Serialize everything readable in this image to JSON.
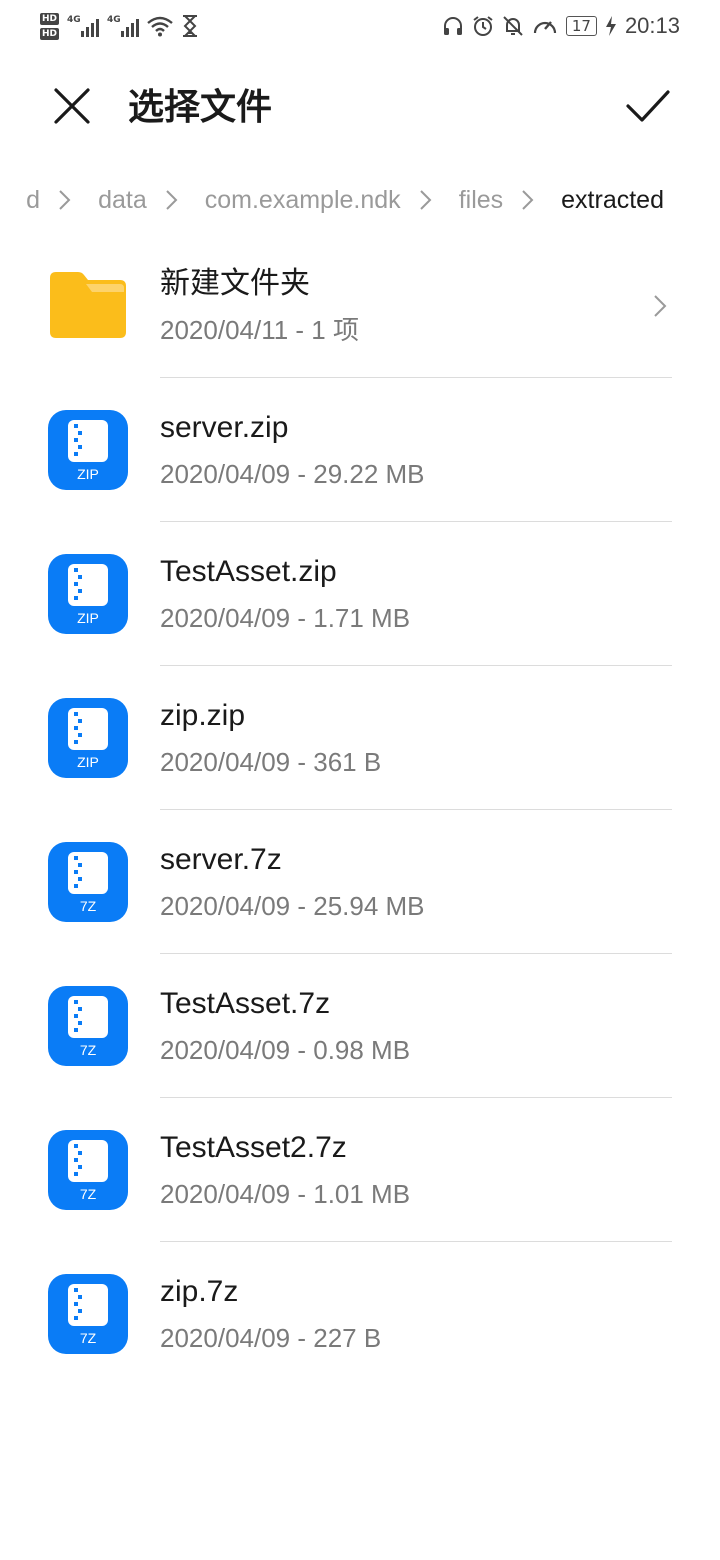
{
  "status_bar": {
    "hd1": "HD",
    "hd2": "HD",
    "net1": "4G",
    "net2": "4G",
    "battery": "17",
    "time": "20:13"
  },
  "header": {
    "title": "选择文件"
  },
  "breadcrumb": [
    {
      "label": "d"
    },
    {
      "label": "data"
    },
    {
      "label": "com.example.ndk"
    },
    {
      "label": "files"
    },
    {
      "label": "extracted"
    }
  ],
  "files": [
    {
      "name": "新建文件夹",
      "meta": "2020/04/11 - 1 项",
      "type": "folder"
    },
    {
      "name": "server.zip",
      "meta": "2020/04/09 - 29.22 MB",
      "type": "ZIP"
    },
    {
      "name": "TestAsset.zip",
      "meta": "2020/04/09 - 1.71 MB",
      "type": "ZIP"
    },
    {
      "name": "zip.zip",
      "meta": "2020/04/09 - 361 B",
      "type": "ZIP"
    },
    {
      "name": "server.7z",
      "meta": "2020/04/09 - 25.94 MB",
      "type": "7Z"
    },
    {
      "name": "TestAsset.7z",
      "meta": "2020/04/09 - 0.98 MB",
      "type": "7Z"
    },
    {
      "name": "TestAsset2.7z",
      "meta": "2020/04/09 - 1.01 MB",
      "type": "7Z"
    },
    {
      "name": "zip.7z",
      "meta": "2020/04/09 - 227 B",
      "type": "7Z"
    }
  ],
  "colors": {
    "accent": "#0a7cf6",
    "folder": "#fbbd1b",
    "folder_tab": "#fdd36b"
  }
}
